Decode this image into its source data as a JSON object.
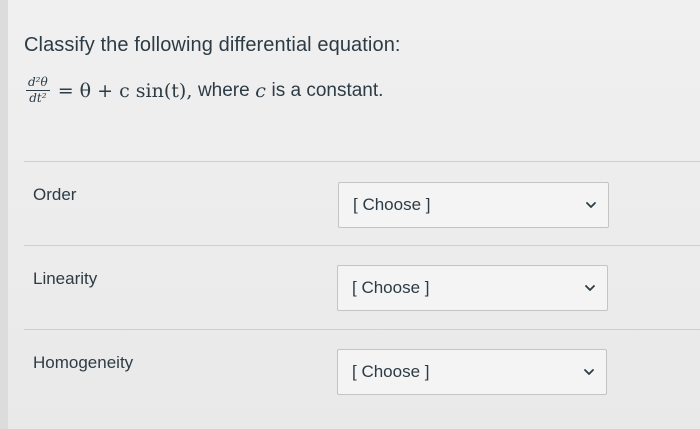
{
  "question": {
    "title": "Classify the following differential equation:",
    "equation": {
      "numerator": "d²θ",
      "denominator": "dt²",
      "rhs_math": "= θ + c sin(t),",
      "rhs_text": "where",
      "var_c": "c",
      "tail_text": "is a constant."
    }
  },
  "rows": [
    {
      "label": "Order",
      "select_value": "[ Choose ]"
    },
    {
      "label": "Linearity",
      "select_value": "[ Choose ]"
    },
    {
      "label": "Homogeneity",
      "select_value": "[ Choose ]"
    }
  ],
  "icons": {
    "dropdown": "chevron-down-icon"
  }
}
